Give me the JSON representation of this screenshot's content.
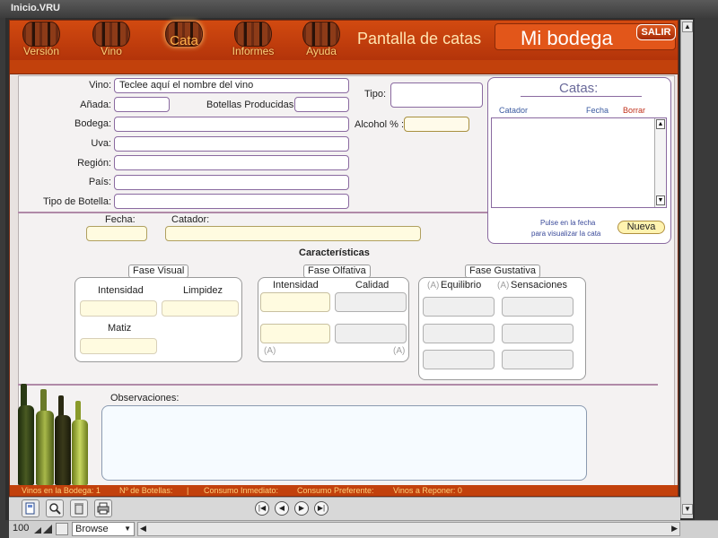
{
  "window": {
    "title": "Inicio.VRU"
  },
  "header": {
    "nav": [
      {
        "label": "Versión"
      },
      {
        "label": "Vino"
      },
      {
        "label": "Cata"
      },
      {
        "label": "Informes"
      },
      {
        "label": "Ayuda"
      }
    ],
    "screen_title": "Pantalla de catas",
    "brand": "Mi bodega",
    "salir_label": "SALIR"
  },
  "wine": {
    "vino_label": "Vino:",
    "vino_placeholder": "Teclee aquí el nombre del vino",
    "anada_label": "Añada:",
    "botellas_label": "Botellas Producidas:",
    "bodega_label": "Bodega:",
    "uva_label": "Uva:",
    "region_label": "Región:",
    "pais_label": "País:",
    "tipo_botella_label": "Tipo de Botella:",
    "tipo_label": "Tipo:",
    "alcohol_label": "Alcohol % :"
  },
  "catas": {
    "title": "Catas:",
    "col_catador": "Catador",
    "col_fecha": "Fecha",
    "col_borrar": "Borrar",
    "hint_line1": "Pulse en la fecha",
    "hint_line2": "para visualizar la cata",
    "nueva_label": "Nueva"
  },
  "tasting": {
    "fecha_label": "Fecha:",
    "catador_label": "Catador:",
    "caracteristicas_label": "Características",
    "visual": {
      "title": "Fase Visual",
      "intensidad": "Intensidad",
      "limpidez": "Limpidez",
      "matiz": "Matiz"
    },
    "olfativa": {
      "title": "Fase Olfativa",
      "intensidad": "Intensidad",
      "calidad": "Calidad",
      "hint": "(A)"
    },
    "gustativa": {
      "title": "Fase Gustativa",
      "equilibrio": "Equilibrio",
      "sensaciones": "Sensaciones",
      "hint": "(A)"
    },
    "observaciones_label": "Observaciones:"
  },
  "status": {
    "vinos_bodega": "Vinos en la Bodega: 1",
    "botellas": "Nº de Botellas:",
    "separator": "|",
    "consumo_inmediato": "Consumo Inmediato:",
    "consumo_preferente": "Consumo Preferente:",
    "vinos_reponer": "Vinos a Reponer: 0"
  },
  "bottom": {
    "zoom": "100",
    "mode": "Browse"
  },
  "colors": {
    "header": "#c2410c",
    "accent_text": "#ffd07a",
    "field_border": "#8a6aa0"
  },
  "icons": [
    "new-record-icon",
    "find-icon",
    "trash-icon",
    "print-icon",
    "first-icon",
    "prev-icon",
    "next-icon",
    "last-icon"
  ]
}
